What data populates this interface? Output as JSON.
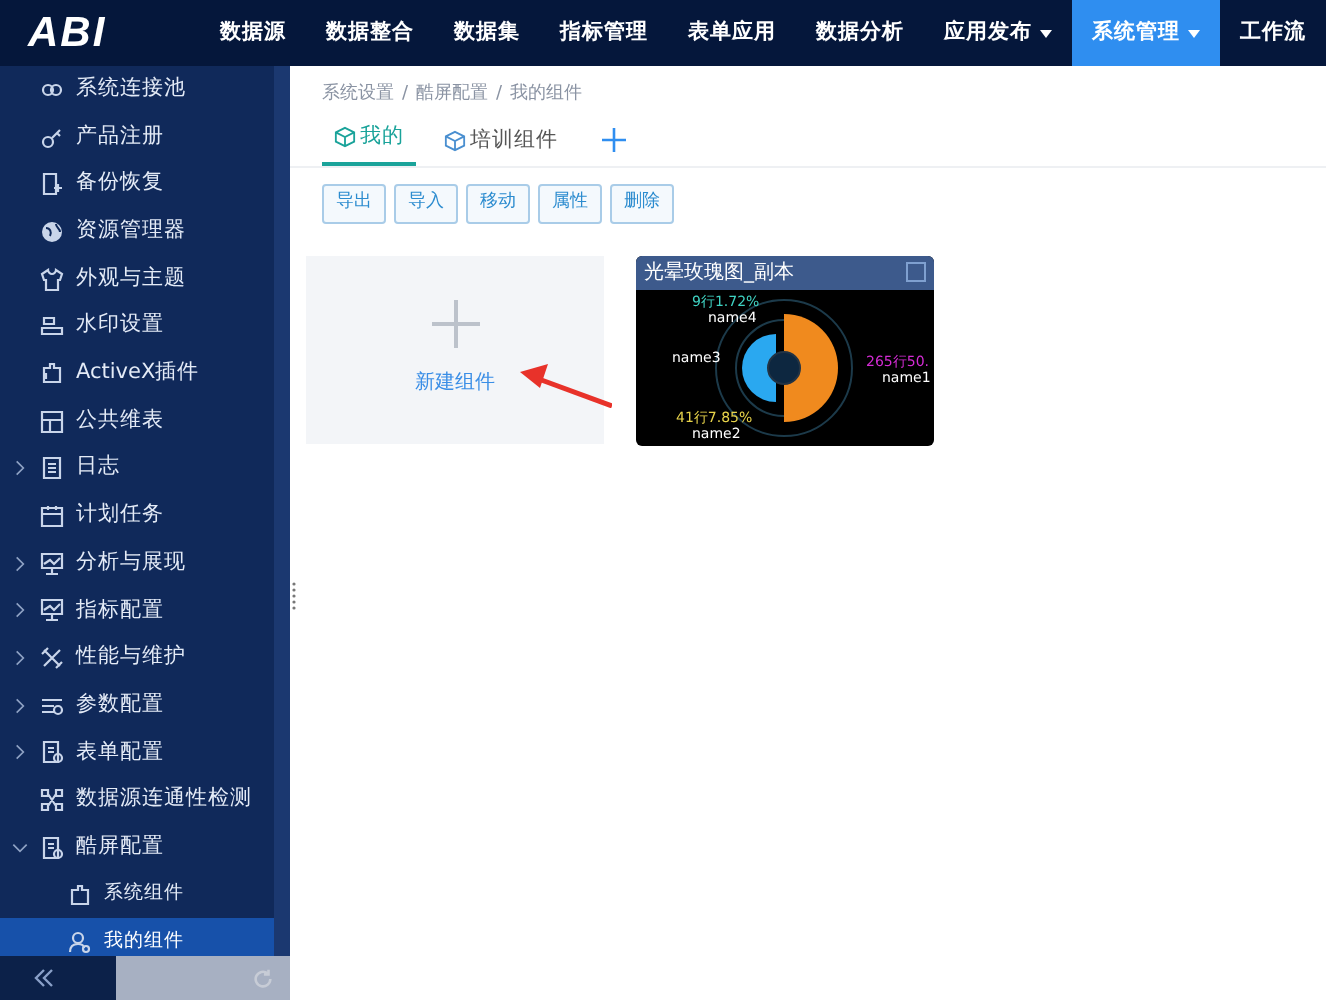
{
  "header": {
    "logo": "ABI",
    "nav": [
      {
        "label": "数据源",
        "selected": false,
        "dropdown": false
      },
      {
        "label": "数据整合",
        "selected": false,
        "dropdown": false
      },
      {
        "label": "数据集",
        "selected": false,
        "dropdown": false
      },
      {
        "label": "指标管理",
        "selected": false,
        "dropdown": false
      },
      {
        "label": "表单应用",
        "selected": false,
        "dropdown": false
      },
      {
        "label": "数据分析",
        "selected": false,
        "dropdown": false
      },
      {
        "label": "应用发布",
        "selected": false,
        "dropdown": true
      },
      {
        "label": "系统管理",
        "selected": true,
        "dropdown": true
      },
      {
        "label": "工作流",
        "selected": false,
        "dropdown": false
      }
    ]
  },
  "sidebar": {
    "items": [
      {
        "kind": "leaf",
        "label": "系统连接池",
        "selected": false
      },
      {
        "kind": "leaf",
        "label": "产品注册",
        "selected": false
      },
      {
        "kind": "leaf",
        "label": "备份恢复",
        "selected": false
      },
      {
        "kind": "leaf",
        "label": "资源管理器",
        "selected": false
      },
      {
        "kind": "leaf",
        "label": "外观与主题",
        "selected": false
      },
      {
        "kind": "leaf",
        "label": "水印设置",
        "selected": false
      },
      {
        "kind": "leaf",
        "label": "ActiveX插件",
        "selected": false
      },
      {
        "kind": "leaf",
        "label": "公共维表",
        "selected": false
      },
      {
        "kind": "group",
        "label": "日志",
        "selected": false,
        "expanded": false
      },
      {
        "kind": "leaf",
        "label": "计划任务",
        "selected": false
      },
      {
        "kind": "group",
        "label": "分析与展现",
        "selected": false,
        "expanded": false
      },
      {
        "kind": "group",
        "label": "指标配置",
        "selected": false,
        "expanded": false
      },
      {
        "kind": "group",
        "label": "性能与维护",
        "selected": false,
        "expanded": false
      },
      {
        "kind": "group",
        "label": "参数配置",
        "selected": false,
        "expanded": false
      },
      {
        "kind": "group",
        "label": "表单配置",
        "selected": false,
        "expanded": false
      },
      {
        "kind": "leaf",
        "label": "数据源连通性检测",
        "selected": false
      },
      {
        "kind": "group",
        "label": "酷屏配置",
        "selected": false,
        "expanded": true,
        "children": [
          {
            "label": "系统组件",
            "selected": false
          },
          {
            "label": "我的组件",
            "selected": true
          }
        ]
      }
    ]
  },
  "breadcrumb": {
    "separator": "/",
    "items": [
      "系统设置",
      "酷屏配置",
      "我的组件"
    ]
  },
  "tabs": [
    {
      "label": "我的",
      "selected": true
    },
    {
      "label": "培训组件",
      "selected": false
    }
  ],
  "toolbar": [
    "导出",
    "导入",
    "移动",
    "属性",
    "删除"
  ],
  "new_card": {
    "label": "新建组件"
  },
  "components": [
    {
      "title": "光晕玫瑰图_副本",
      "checked": false,
      "slices": [
        {
          "name": "name4",
          "value_label": "9行1.72%",
          "color": "#3fd3c3"
        },
        {
          "name": "name3",
          "color": "#ffffff"
        },
        {
          "name": "name1",
          "value_label": "265行50.",
          "color": "#d42bd4"
        },
        {
          "name": "name2",
          "value_label": "41行7.85%",
          "color": "#e6d24a"
        }
      ]
    }
  ]
}
